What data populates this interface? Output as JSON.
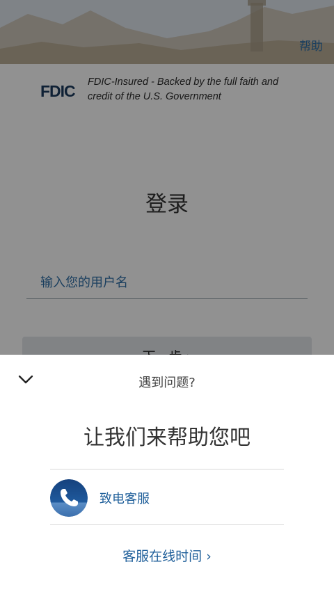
{
  "header": {
    "help_label": "帮助"
  },
  "fdic": {
    "logo_text": "FDIC",
    "tagline": "FDIC-Insured - Backed by the full faith and credit of the U.S. Government"
  },
  "login": {
    "title": "登录",
    "username_placeholder": "输入您的用户名",
    "next_label": "下一步 ›"
  },
  "sheet": {
    "header": "遇到问题?",
    "title": "让我们来帮助您吧",
    "call_label": "致电客服",
    "hours_label": "客服在线时间 ›"
  },
  "icons": {
    "collapse": "chevron-down-icon",
    "phone": "phone-icon"
  },
  "colors": {
    "link_blue": "#1f5f9a",
    "overlay": "rgba(0,0,0,0.43)",
    "phone_circle": "#1a4a8a"
  }
}
